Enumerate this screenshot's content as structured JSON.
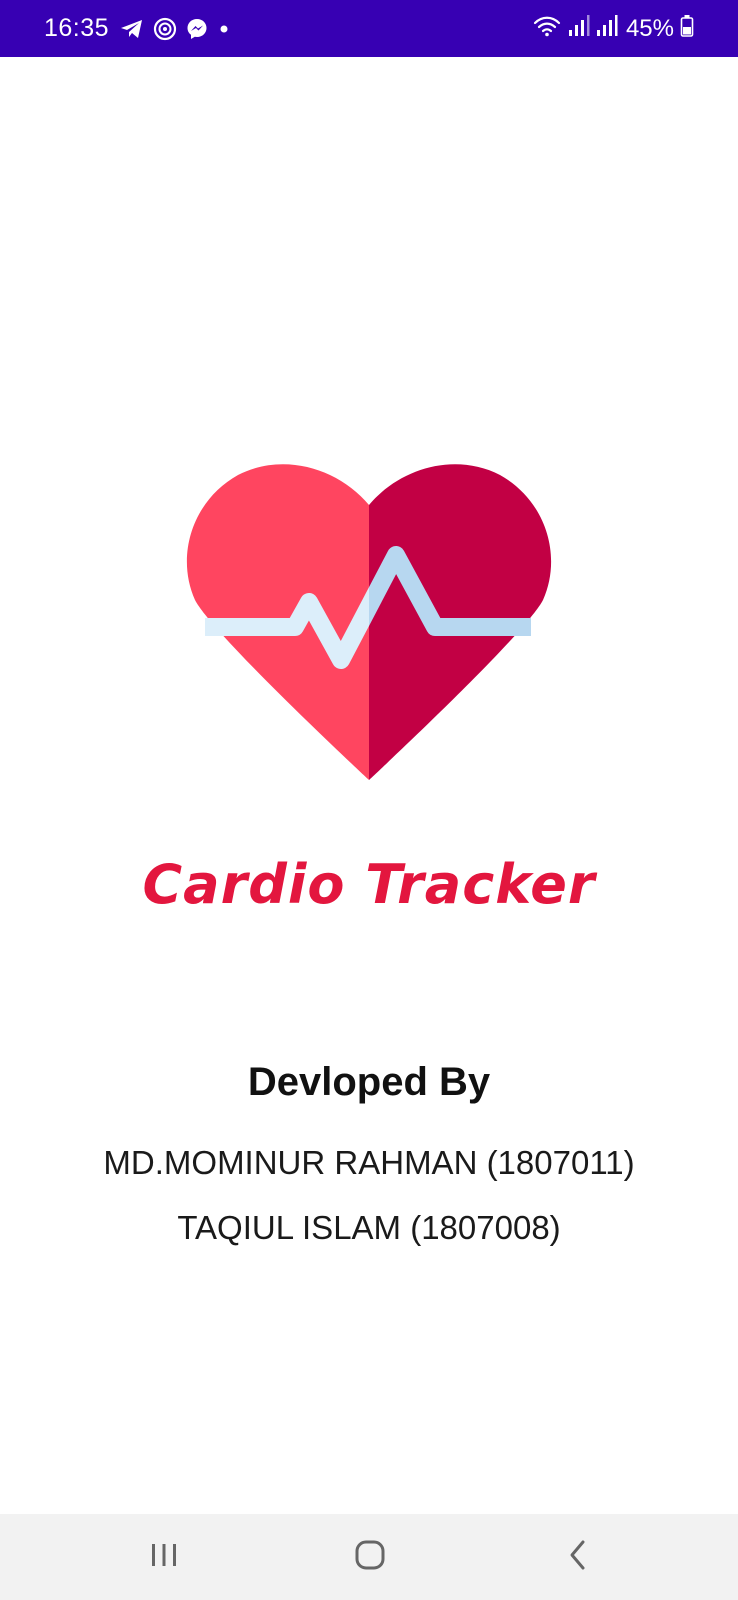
{
  "status_bar": {
    "time": "16:35",
    "left_icons": [
      "telegram-icon",
      "podcast-icon",
      "messenger-icon",
      "notification-dot-icon"
    ],
    "right_icons": [
      "wifi-icon",
      "signal-icon",
      "signal-icon",
      "battery-icon"
    ],
    "battery": "45%",
    "background": "#3700B3"
  },
  "app": {
    "logo_icon": "heart-pulse-icon",
    "title": "Cardio Tracker",
    "title_color": "#E3163E",
    "heart_colors": {
      "left": "#FF4560",
      "right": "#C20044",
      "pulse": "#DCEEFA"
    }
  },
  "credits": {
    "heading": "Devloped By",
    "developers": [
      "MD.MOMINUR RAHMAN (1807011)",
      "TAQIUL ISLAM (1807008)"
    ]
  },
  "nav_bar": {
    "buttons": [
      "recents-icon",
      "home-icon",
      "back-icon"
    ]
  }
}
